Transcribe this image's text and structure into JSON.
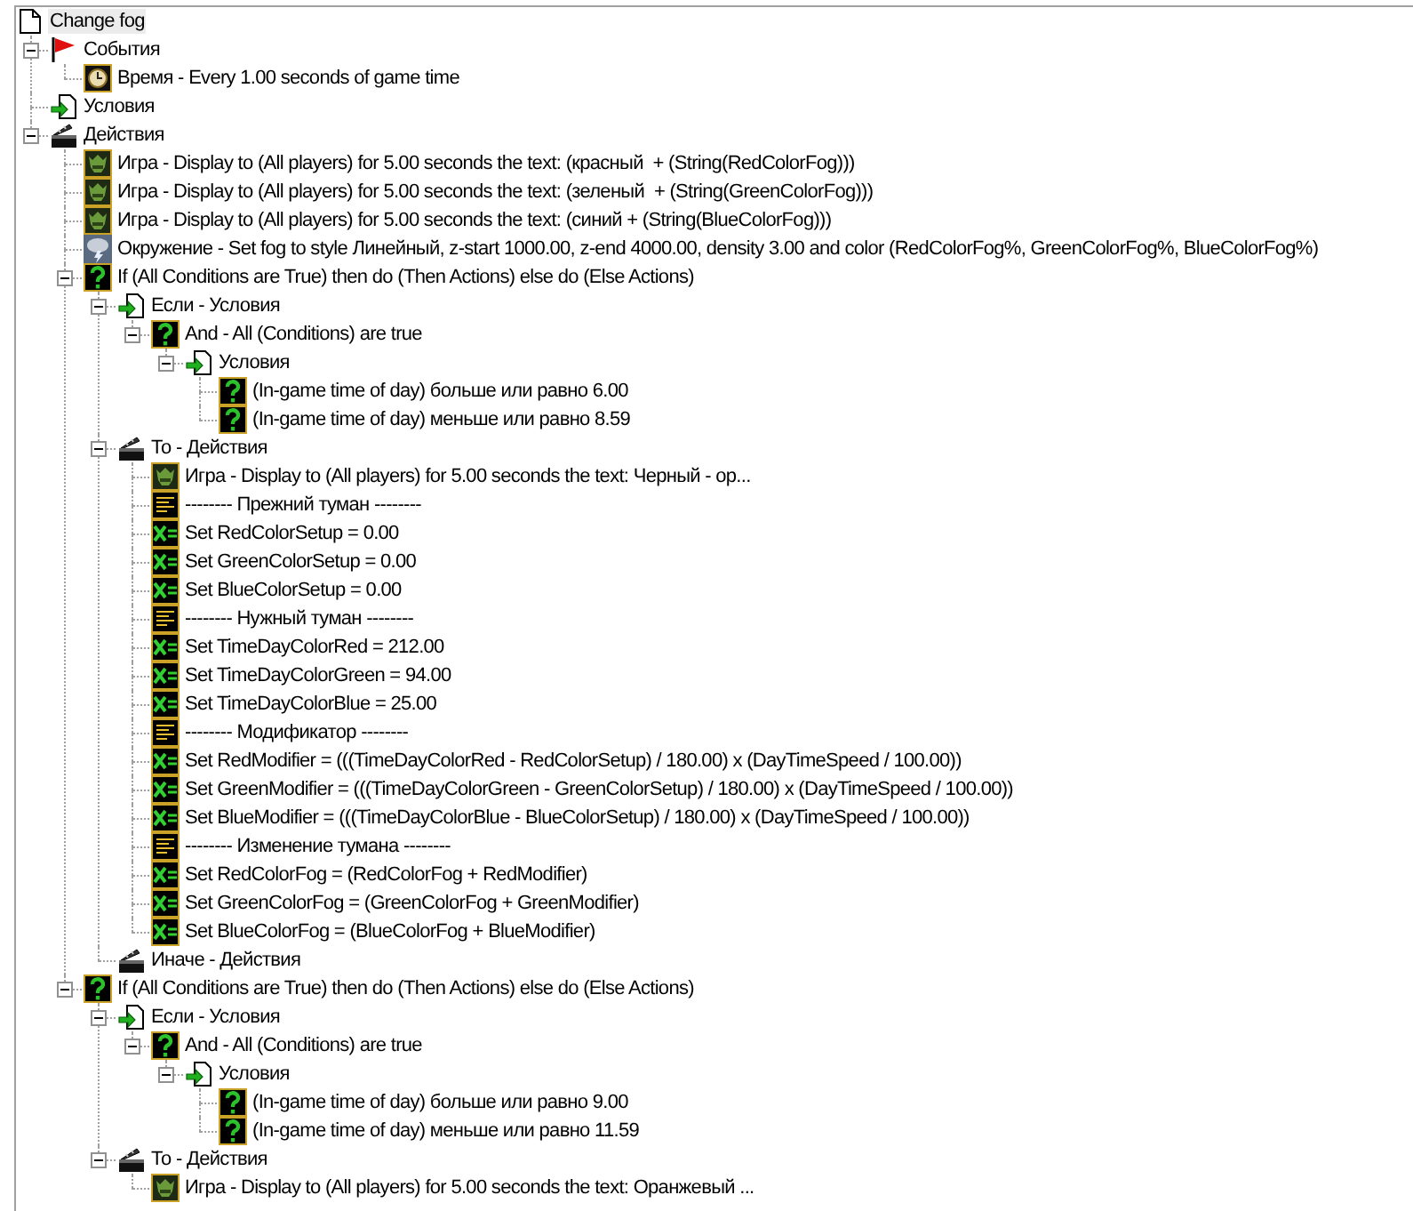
{
  "tree": {
    "kind": "trigger",
    "label": "Change fog",
    "selected": true,
    "children": [
      {
        "kind": "events",
        "label": "События",
        "selected": false,
        "expanded": true,
        "children": [
          {
            "kind": "clock",
            "label": "Время - Every 1.00 seconds of game time",
            "selected": false
          }
        ]
      },
      {
        "kind": "conditions",
        "label": "Условия",
        "selected": false
      },
      {
        "kind": "actions",
        "label": "Действия",
        "selected": false,
        "expanded": true,
        "children": [
          {
            "kind": "game",
            "label": "Игра - Display to (All players) for 5.00 seconds the text: (красный  + (String(RedColorFog)))",
            "selected": false
          },
          {
            "kind": "game",
            "label": "Игра - Display to (All players) for 5.00 seconds the text: (зеленый  + (String(GreenColorFog)))",
            "selected": false
          },
          {
            "kind": "game",
            "label": "Игра - Display to (All players) for 5.00 seconds the text: (синий + (String(BlueColorFog)))",
            "selected": false
          },
          {
            "kind": "environment",
            "label": "Окружение - Set fog to style Линейный, z-start 1000.00, z-end 4000.00, density 3.00 and color (RedColorFog%, GreenColorFog%, BlueColorFog%)",
            "selected": false
          },
          {
            "kind": "condition",
            "label": "If (All Conditions are True) then do (Then Actions) else do (Else Actions)",
            "selected": false,
            "expanded": true,
            "children": [
              {
                "kind": "conditions",
                "label": "Если - Условия",
                "selected": false,
                "expanded": true,
                "children": [
                  {
                    "kind": "condition",
                    "label": "And - All (Conditions) are true",
                    "selected": false,
                    "expanded": true,
                    "children": [
                      {
                        "kind": "conditions",
                        "label": "Условия",
                        "selected": false,
                        "expanded": true,
                        "children": [
                          {
                            "kind": "condition",
                            "label": "(In-game time of day) больше или равно 6.00",
                            "selected": false
                          },
                          {
                            "kind": "condition",
                            "label": "(In-game time of day) меньше или равно 8.59",
                            "selected": false
                          }
                        ]
                      }
                    ]
                  }
                ]
              },
              {
                "kind": "actions",
                "label": "То - Действия",
                "selected": false,
                "expanded": true,
                "children": [
                  {
                    "kind": "game",
                    "label": "Игра - Display to (All players) for 5.00 seconds the text: Черный - ор...",
                    "selected": false
                  },
                  {
                    "kind": "comment",
                    "label": "-------- Прежний туман --------",
                    "selected": false
                  },
                  {
                    "kind": "set",
                    "label": "Set RedColorSetup = 0.00",
                    "selected": false
                  },
                  {
                    "kind": "set",
                    "label": "Set GreenColorSetup = 0.00",
                    "selected": false
                  },
                  {
                    "kind": "set",
                    "label": "Set BlueColorSetup = 0.00",
                    "selected": false
                  },
                  {
                    "kind": "comment",
                    "label": "-------- Нужный туман --------",
                    "selected": false
                  },
                  {
                    "kind": "set",
                    "label": "Set TimeDayColorRed = 212.00",
                    "selected": false
                  },
                  {
                    "kind": "set",
                    "label": "Set TimeDayColorGreen = 94.00",
                    "selected": false
                  },
                  {
                    "kind": "set",
                    "label": "Set TimeDayColorBlue = 25.00",
                    "selected": false
                  },
                  {
                    "kind": "comment",
                    "label": "-------- Модификатор --------",
                    "selected": false
                  },
                  {
                    "kind": "set",
                    "label": "Set RedModifier = (((TimeDayColorRed - RedColorSetup) / 180.00) x (DayTimeSpeed / 100.00))",
                    "selected": false
                  },
                  {
                    "kind": "set",
                    "label": "Set GreenModifier = (((TimeDayColorGreen - GreenColorSetup) / 180.00) x (DayTimeSpeed / 100.00))",
                    "selected": false
                  },
                  {
                    "kind": "set",
                    "label": "Set BlueModifier = (((TimeDayColorBlue - BlueColorSetup) / 180.00) x (DayTimeSpeed / 100.00))",
                    "selected": false
                  },
                  {
                    "kind": "comment",
                    "label": "-------- Изменение тумана --------",
                    "selected": false
                  },
                  {
                    "kind": "set",
                    "label": "Set RedColorFog = (RedColorFog + RedModifier)",
                    "selected": false
                  },
                  {
                    "kind": "set",
                    "label": "Set GreenColorFog = (GreenColorFog + GreenModifier)",
                    "selected": false
                  },
                  {
                    "kind": "set",
                    "label": "Set BlueColorFog = (BlueColorFog + BlueModifier)",
                    "selected": false
                  }
                ]
              },
              {
                "kind": "actions",
                "label": "Иначе - Действия",
                "selected": false
              }
            ]
          },
          {
            "kind": "condition",
            "label": "If (All Conditions are True) then do (Then Actions) else do (Else Actions)",
            "selected": false,
            "expanded": true,
            "children": [
              {
                "kind": "conditions",
                "label": "Если - Условия",
                "selected": false,
                "expanded": true,
                "children": [
                  {
                    "kind": "condition",
                    "label": "And - All (Conditions) are true",
                    "selected": false,
                    "expanded": true,
                    "children": [
                      {
                        "kind": "conditions",
                        "label": "Условия",
                        "selected": false,
                        "expanded": true,
                        "children": [
                          {
                            "kind": "condition",
                            "label": "(In-game time of day) больше или равно 9.00",
                            "selected": false
                          },
                          {
                            "kind": "condition",
                            "label": "(In-game time of day) меньше или равно 11.59",
                            "selected": false
                          }
                        ]
                      }
                    ]
                  }
                ]
              },
              {
                "kind": "actions",
                "label": "То - Действия",
                "selected": false,
                "expanded": true,
                "children": [
                  {
                    "kind": "game",
                    "label": "Игра - Display to (All players) for 5.00 seconds the text: Оранжевый ...",
                    "selected": false
                  }
                ]
              }
            ]
          }
        ]
      }
    ]
  }
}
